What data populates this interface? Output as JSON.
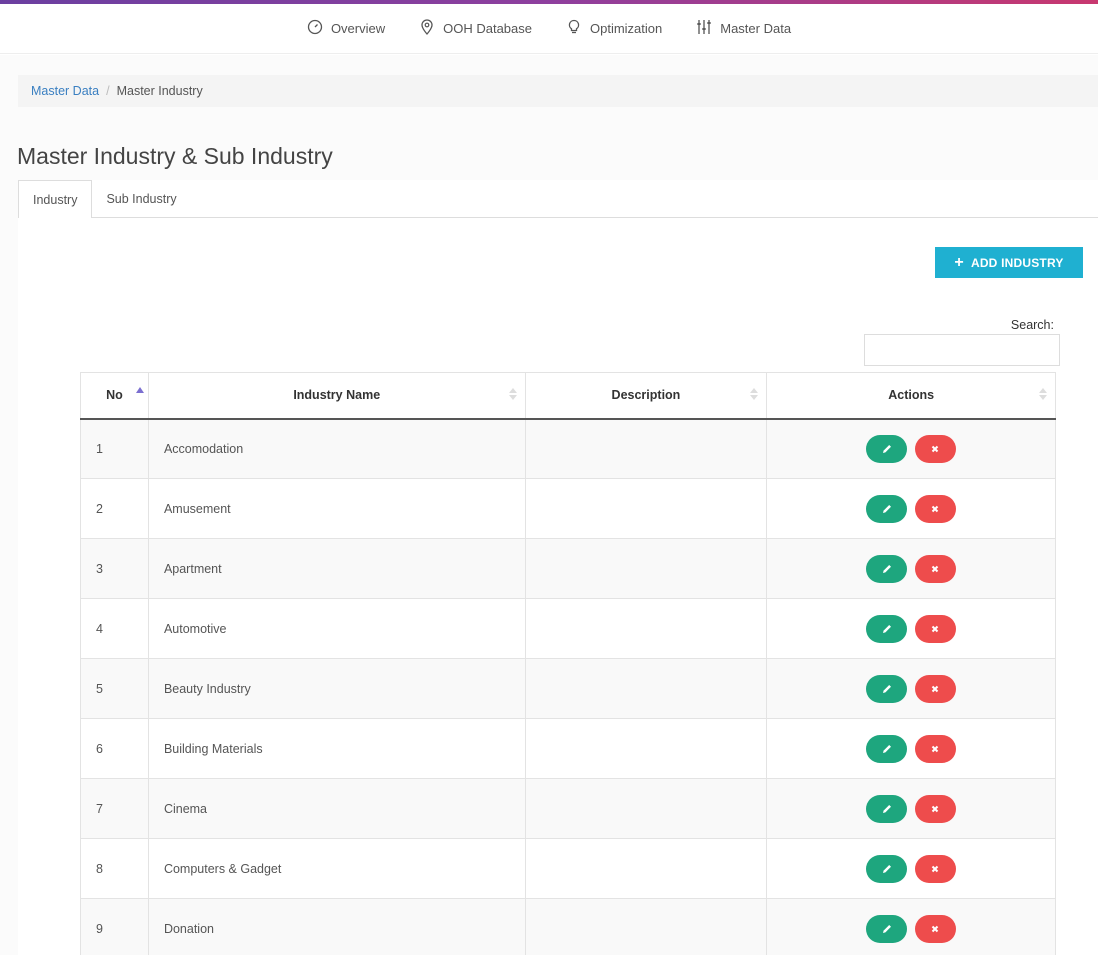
{
  "nav": {
    "items": [
      {
        "label": "Overview",
        "icon": "dashboard-icon"
      },
      {
        "label": "OOH Database",
        "icon": "map-pin-icon"
      },
      {
        "label": "Optimization",
        "icon": "lightbulb-icon"
      },
      {
        "label": "Master Data",
        "icon": "sliders-icon"
      }
    ]
  },
  "breadcrumb": {
    "parent": "Master Data",
    "separator": "/",
    "current": "Master Industry"
  },
  "page": {
    "title": "Master Industry & Sub Industry"
  },
  "tabs": [
    {
      "label": "Industry",
      "active": true
    },
    {
      "label": "Sub Industry",
      "active": false
    }
  ],
  "toolbar": {
    "add_label": "ADD INDUSTRY",
    "search_label": "Search:"
  },
  "table": {
    "headers": [
      "No",
      "Industry Name",
      "Description",
      "Actions"
    ],
    "rows": [
      {
        "no": "1",
        "name": "Accomodation",
        "description": ""
      },
      {
        "no": "2",
        "name": "Amusement",
        "description": ""
      },
      {
        "no": "3",
        "name": "Apartment",
        "description": ""
      },
      {
        "no": "4",
        "name": "Automotive",
        "description": ""
      },
      {
        "no": "5",
        "name": "Beauty Industry",
        "description": ""
      },
      {
        "no": "6",
        "name": "Building Materials",
        "description": ""
      },
      {
        "no": "7",
        "name": "Cinema",
        "description": ""
      },
      {
        "no": "8",
        "name": "Computers & Gadget",
        "description": ""
      },
      {
        "no": "9",
        "name": "Donation",
        "description": ""
      }
    ]
  },
  "colors": {
    "accent": "#1fb0d1",
    "edit": "#1ea67e",
    "delete": "#ee4c4c",
    "link": "#3a7fc1"
  }
}
